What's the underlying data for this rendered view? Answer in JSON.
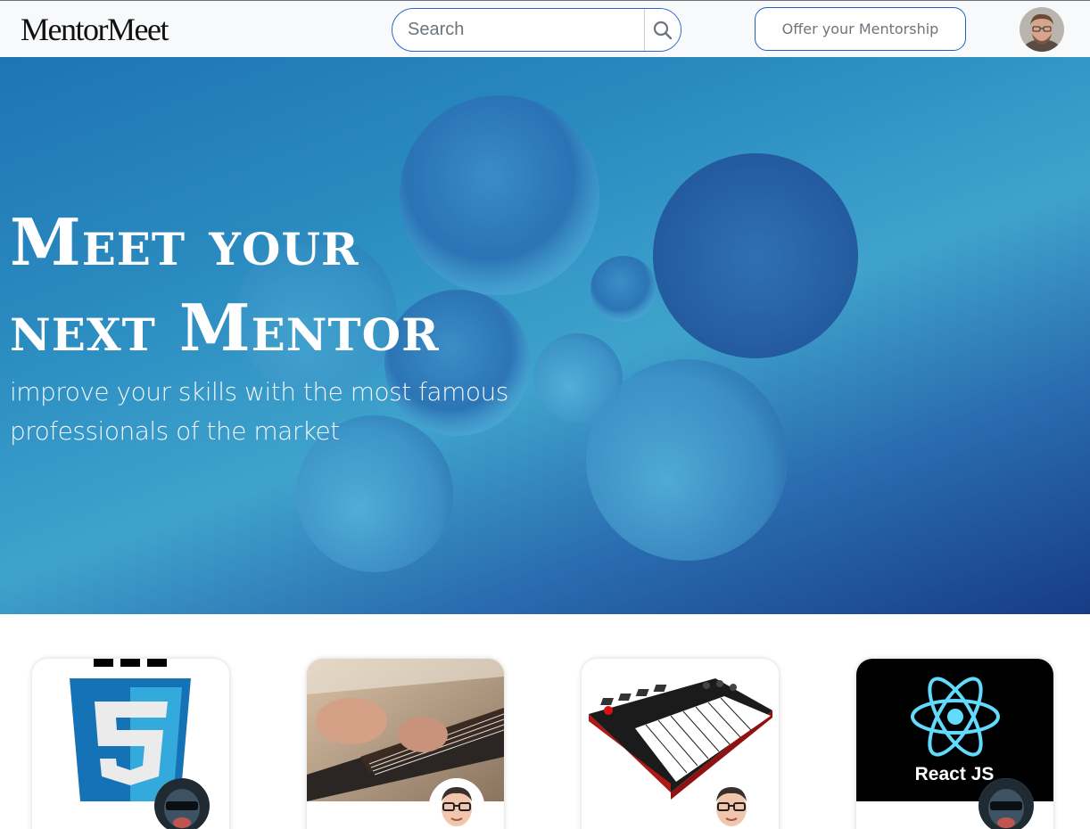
{
  "navbar": {
    "brand": "MentorMeet",
    "search": {
      "placeholder": "Search",
      "value": ""
    },
    "offer_button_label": "Offer your Mentorship"
  },
  "hero": {
    "title_line1": "Meet your",
    "title_line2": "next Mentor",
    "subtitle": "improve your skills with the most famous professionals of the market"
  },
  "cards": [
    {
      "image": "css3-logo",
      "mentor_avatar": "dark-avatar-icon"
    },
    {
      "image": "bass-guitar-photo",
      "mentor_avatar": "cartoon-avatar-icon"
    },
    {
      "image": "midi-keyboard-photo",
      "mentor_avatar": "cartoon-avatar-icon"
    },
    {
      "image": "react-logo",
      "label": "React JS",
      "mentor_avatar": "dark-avatar-icon"
    }
  ],
  "colors": {
    "accent": "#1f5fc6",
    "navbar_bg": "#f8f9fa",
    "hero_light": "#3fa3cc",
    "hero_dark": "#173c86",
    "react_blue": "#61dafb",
    "css3_blue": "#1572b6"
  }
}
